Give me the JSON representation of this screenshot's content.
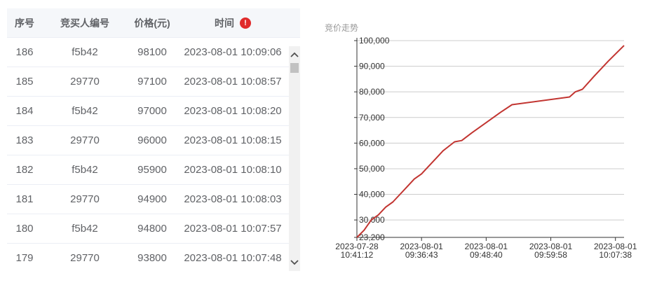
{
  "table": {
    "headers": {
      "seq": "序号",
      "bidder": "竞买人编号",
      "price": "价格(元)",
      "time": "时间"
    },
    "warning_icon": "!",
    "rows": [
      {
        "seq": "186",
        "bidder": "f5b42",
        "price": "98100",
        "time": "2023-08-01 10:09:06"
      },
      {
        "seq": "185",
        "bidder": "29770",
        "price": "97100",
        "time": "2023-08-01 10:08:57"
      },
      {
        "seq": "184",
        "bidder": "f5b42",
        "price": "97000",
        "time": "2023-08-01 10:08:20"
      },
      {
        "seq": "183",
        "bidder": "29770",
        "price": "96000",
        "time": "2023-08-01 10:08:15"
      },
      {
        "seq": "182",
        "bidder": "f5b42",
        "price": "95900",
        "time": "2023-08-01 10:08:10"
      },
      {
        "seq": "181",
        "bidder": "29770",
        "price": "94900",
        "time": "2023-08-01 10:08:03"
      },
      {
        "seq": "180",
        "bidder": "f5b42",
        "price": "94800",
        "time": "2023-08-01 10:07:57"
      },
      {
        "seq": "179",
        "bidder": "29770",
        "price": "93800",
        "time": "2023-08-01 10:07:48"
      }
    ]
  },
  "chart_data": {
    "type": "line",
    "title": "竞价走势",
    "line_color": "#c23531",
    "ylim": [
      23200,
      100000
    ],
    "y_ticks": [
      {
        "value": 100000,
        "label": "100,000"
      },
      {
        "value": 90000,
        "label": "90,000"
      },
      {
        "value": 80000,
        "label": "80,000"
      },
      {
        "value": 70000,
        "label": "70,000"
      },
      {
        "value": 60000,
        "label": "60,000"
      },
      {
        "value": 50000,
        "label": "50,000"
      },
      {
        "value": 40000,
        "label": "40,000"
      },
      {
        "value": 30000,
        "label": "30,000"
      },
      {
        "value": 23200,
        "label": "23,200"
      }
    ],
    "x_count": 186,
    "x_ticks": [
      {
        "index": 0,
        "date": "2023-07-28",
        "time": "10:41:12"
      },
      {
        "index": 45,
        "date": "2023-08-01",
        "time": "09:36:43"
      },
      {
        "index": 90,
        "date": "2023-08-01",
        "time": "09:48:40"
      },
      {
        "index": 135,
        "date": "2023-08-01",
        "time": "09:59:58"
      },
      {
        "index": 180,
        "date": "2023-08-01",
        "time": "10:07:38"
      }
    ],
    "series": [
      {
        "values": [
          [
            0,
            23200
          ],
          [
            5,
            26000
          ],
          [
            10,
            30000
          ],
          [
            15,
            32000
          ],
          [
            20,
            35000
          ],
          [
            25,
            37000
          ],
          [
            30,
            40000
          ],
          [
            35,
            43000
          ],
          [
            40,
            46000
          ],
          [
            45,
            48000
          ],
          [
            50,
            51000
          ],
          [
            55,
            54000
          ],
          [
            60,
            57000
          ],
          [
            68,
            60500
          ],
          [
            73,
            61000
          ],
          [
            80,
            64000
          ],
          [
            90,
            68000
          ],
          [
            100,
            72000
          ],
          [
            108,
            75000
          ],
          [
            148,
            78000
          ],
          [
            152,
            80000
          ],
          [
            157,
            81000
          ],
          [
            165,
            86000
          ],
          [
            175,
            92000
          ],
          [
            186,
            98100
          ]
        ]
      }
    ]
  }
}
